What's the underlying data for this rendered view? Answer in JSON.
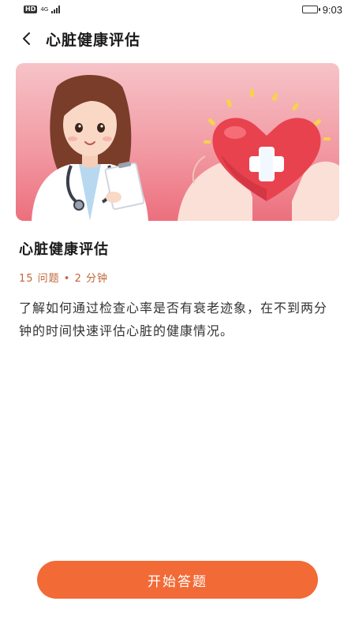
{
  "status_bar": {
    "hd": "HD",
    "network": "4G",
    "time": "9:03",
    "battery_level": 0.9
  },
  "header": {
    "title": "心脏健康评估"
  },
  "assessment": {
    "title": "心脏健康评估",
    "meta": "15 问题 • 2 分钟",
    "description": "了解如何通过检查心率是否有衰老迹象，在不到两分钟的时间快速评估心脏的健康情况。"
  },
  "start_button": {
    "label": "开始答题"
  },
  "colors": {
    "accent": "#f26a36",
    "meta_text": "#c0663a",
    "banner_gradient_top": "#f6c3c8",
    "banner_gradient_bottom": "#ec6f7d"
  },
  "icons": {
    "back": "chevron-left-icon",
    "battery": "battery-icon",
    "signal": "signal-icon"
  }
}
